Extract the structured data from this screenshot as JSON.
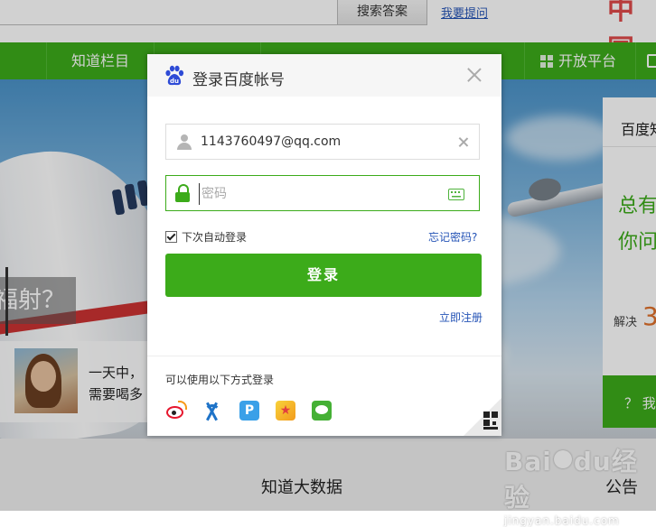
{
  "topbar": {
    "search_button": "搜索答案",
    "ask_link": "我要提问",
    "logo_fragment": "中国"
  },
  "nav": {
    "items": [
      {
        "label": "知道栏目"
      },
      {
        "label": "开放平台"
      }
    ]
  },
  "hero": {
    "banner_text": "福射？",
    "promo_line1": "一天中，",
    "promo_line2": "需要喝多"
  },
  "side_card": {
    "title": "百度知",
    "line1": "总有",
    "line2": "你问",
    "solved_label": "解决",
    "solved_num": "3",
    "ask_button": "？ 我"
  },
  "footer": {
    "title": "知道大数据",
    "notice": "公告",
    "watermark_main_left": "Bai",
    "watermark_main_right": "du",
    "watermark_main_suffix": "经验",
    "watermark_sub": "jingyan.baidu.com"
  },
  "dialog": {
    "title": "登录百度帐号",
    "username_value": "1143760497@qq.com",
    "password_placeholder": "密码",
    "remember_label": "下次自动登录",
    "remember_checked": true,
    "forgot_link": "忘记密码?",
    "login_button": "登录",
    "register_link": "立即注册",
    "other_login_label": "可以使用以下方式登录",
    "social_icons": [
      "weibo-icon",
      "renren-icon",
      "baidu-wallet-icon",
      "qzone-icon",
      "wechat-icon"
    ]
  },
  "colors": {
    "brand_green": "#3cab1a",
    "link_blue": "#2453b6",
    "dialog_header": "#f6f6f6"
  }
}
